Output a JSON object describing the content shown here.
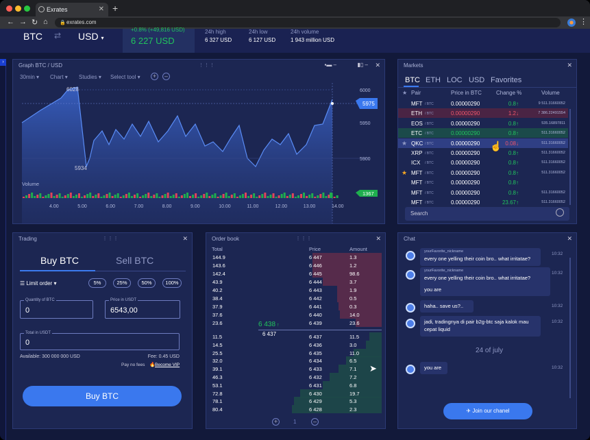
{
  "browser": {
    "tab_title": "Exrates",
    "url": "exrates.com"
  },
  "header": {
    "base": "BTC",
    "quote": "USD",
    "change": "+0.8% (+49,816 USD)",
    "price": "6 227 USD",
    "stats": [
      {
        "label": "24h high",
        "value": "6 327 USD"
      },
      {
        "label": "24h low",
        "value": "6 127 USD"
      },
      {
        "label": "24h volume",
        "value": "1 943 million USD"
      }
    ]
  },
  "graph": {
    "title": "Graph BTC / USD",
    "toolbar": [
      "30min",
      "Chart",
      "Studies",
      "Select tool"
    ],
    "y_ticks": [
      "6000",
      "5950",
      "5900"
    ],
    "price_tag": "5975",
    "volume_label": "Volume",
    "volume_tag": "1367",
    "x_ticks": [
      "4.00",
      "5.00",
      "6.00",
      "7.00",
      "8.00",
      "9.00",
      "10.00",
      "11.00",
      "12.00",
      "13.00",
      "14.00"
    ],
    "high_label": "6028",
    "low_label": "5934"
  },
  "markets": {
    "title": "Markets",
    "tabs": [
      "BTC",
      "ETH",
      "LOC",
      "USD",
      "Favorites"
    ],
    "columns": [
      "Pair",
      "Price in BTC",
      "Change %",
      "Volume"
    ],
    "rows": [
      {
        "pair": "MFT",
        "quote": "/ BTC",
        "price": "0.00000290",
        "change": "0.8",
        "dir": "up",
        "volume": "9 511.31660052",
        "star": false,
        "style": ""
      },
      {
        "pair": "ETH",
        "quote": "/ BTC",
        "price": "0.00000290",
        "change": "1.2",
        "dir": "down",
        "volume": "7 386.22491554",
        "star": false,
        "style": "red"
      },
      {
        "pair": "EOS",
        "quote": "/ BTC",
        "price": "0.00000290",
        "change": "0.8",
        "dir": "up",
        "volume": "535.16897811",
        "star": false,
        "style": ""
      },
      {
        "pair": "ETC",
        "quote": "/ BTC",
        "price": "0.00000290",
        "change": "0.8",
        "dir": "up",
        "volume": "511.31660052",
        "star": false,
        "style": "green"
      },
      {
        "pair": "QKC",
        "quote": "/ BTC",
        "price": "0.00000290",
        "change": "0.08",
        "dir": "down",
        "volume": "511.31660052",
        "star": true,
        "style": "hover"
      },
      {
        "pair": "XRP",
        "quote": "/ BTC",
        "price": "0.00000290",
        "change": "0.8",
        "dir": "up",
        "volume": "511.31660052",
        "star": false,
        "style": ""
      },
      {
        "pair": "ICX",
        "quote": "/ BTC",
        "price": "0.00000290",
        "change": "0.8",
        "dir": "up",
        "volume": "511.31660052",
        "star": false,
        "style": ""
      },
      {
        "pair": "MFT",
        "quote": "/ BTC",
        "price": "0.00000290",
        "change": "0.8",
        "dir": "up",
        "volume": "511.31660052",
        "star": "gold",
        "style": ""
      },
      {
        "pair": "MFT",
        "quote": "/ BTC",
        "price": "0.00000290",
        "change": "0.8",
        "dir": "up",
        "volume": "",
        "star": false,
        "style": ""
      },
      {
        "pair": "MFT",
        "quote": "/ BTC",
        "price": "0.00000290",
        "change": "0.8",
        "dir": "up",
        "volume": "511.31660052",
        "star": false,
        "style": ""
      },
      {
        "pair": "MFT",
        "quote": "/ BTC",
        "price": "0.00000290",
        "change": "23.67",
        "dir": "up",
        "volume": "511.31660052",
        "star": false,
        "style": ""
      }
    ],
    "search_placeholder": "Search"
  },
  "trading": {
    "title": "Trading",
    "buy_tab": "Buy BTC",
    "sell_tab": "Sell BTC",
    "order_type": "Limit order",
    "percents": [
      "5%",
      "25%",
      "50%",
      "100%"
    ],
    "qty_label": "Quantity of BTC",
    "qty_value": "0",
    "price_label": "Price in USDT",
    "price_value": "6543,00",
    "total_label": "Total in USDT",
    "total_value": "0",
    "available": "Available: 300 000 000 USD",
    "fee": "Fee: 0.45 USD",
    "pay_no_fees": "Pay no fees",
    "become_vip": "Become VIP",
    "submit": "Buy BTC"
  },
  "orderbook": {
    "title": "Order book",
    "columns": [
      "Total",
      "Price",
      "Amount"
    ],
    "asks": [
      {
        "total": "144.9",
        "price": "6 447",
        "amount": "1.3",
        "depth": 0.56
      },
      {
        "total": "143.6",
        "price": "6 446",
        "amount": "1.2",
        "depth": 0.56
      },
      {
        "total": "142.4",
        "price": "6 445",
        "amount": "98.6",
        "depth": 0.56
      },
      {
        "total": "43.9",
        "price": "6 444",
        "amount": "3.7",
        "depth": 0.48
      },
      {
        "total": "40.2",
        "price": "6 443",
        "amount": "1.9",
        "depth": 0.36
      },
      {
        "total": "38.4",
        "price": "6 442",
        "amount": "0.5",
        "depth": 0.36
      },
      {
        "total": "37.9",
        "price": "6 441",
        "amount": "0.3",
        "depth": 0.35
      },
      {
        "total": "37.6",
        "price": "6 440",
        "amount": "14.0",
        "depth": 0.34
      },
      {
        "total": "23.6",
        "price": "6 439",
        "amount": "23.6",
        "depth": 0.21
      }
    ],
    "mid_price": "6 438",
    "mid_sub": "6 437",
    "bids": [
      {
        "total": "11.5",
        "price": "6 437",
        "amount": "11.5",
        "depth": 0.1
      },
      {
        "total": "14.5",
        "price": "6 436",
        "amount": "3.0",
        "depth": 0.13
      },
      {
        "total": "25.5",
        "price": "6 435",
        "amount": "11.0",
        "depth": 0.23
      },
      {
        "total": "32.0",
        "price": "6 434",
        "amount": "6.5",
        "depth": 0.29
      },
      {
        "total": "39.1",
        "price": "6 433",
        "amount": "7.1",
        "depth": 0.35
      },
      {
        "total": "46.3",
        "price": "6 432",
        "amount": "7.2",
        "depth": 0.42
      },
      {
        "total": "53.1",
        "price": "6 431",
        "amount": "6.8",
        "depth": 0.48
      },
      {
        "total": "72.8",
        "price": "6 430",
        "amount": "19.7",
        "depth": 0.66
      },
      {
        "total": "78.1",
        "price": "6 429",
        "amount": "5.3",
        "depth": 0.71
      },
      {
        "total": "80.4",
        "price": "6 428",
        "amount": "2.3",
        "depth": 0.73
      }
    ],
    "page": "1"
  },
  "chat": {
    "title": "Chat",
    "messages": [
      {
        "name": "yourFavorite_nickname",
        "text": "every one yelling their coin bro.. what irritatae?",
        "time": "10:32"
      },
      {
        "name": "yourFavorite_nickname",
        "text": "every one yelling their coin bro.. what irritatae?",
        "extra": "you are",
        "time": "10:32"
      },
      {
        "name": "",
        "text": "haha.. save us?..",
        "time": "10:32"
      },
      {
        "name": "",
        "text": "jadi, tradingnya di pair b2g-btc saja kalok mau cepat liquid",
        "time": "10:32"
      },
      {
        "name": "",
        "text": "you are",
        "time": "10:32"
      }
    ],
    "date_divider": "24 of july",
    "join": "Join our chanel"
  },
  "colors": {
    "bg": "#12193a",
    "panel": "#1c2652",
    "accent": "#3b7bf0",
    "green": "#21c45d",
    "red": "#f0566b"
  }
}
